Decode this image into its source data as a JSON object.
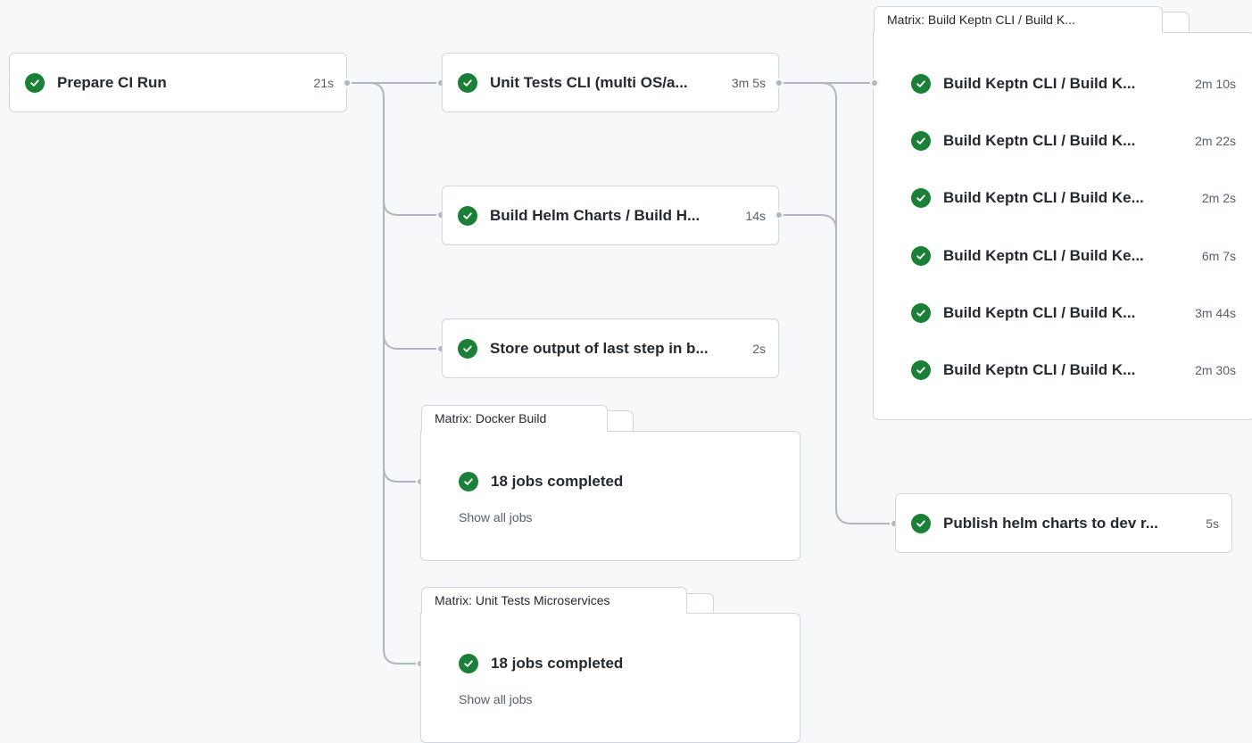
{
  "jobs": {
    "prepare": {
      "name": "Prepare CI Run",
      "duration": "21s"
    },
    "unit_cli": {
      "name": "Unit Tests CLI (multi OS/a...",
      "duration": "3m 5s"
    },
    "helm": {
      "name": "Build Helm Charts / Build H...",
      "duration": "14s"
    },
    "store": {
      "name": "Store output of last step in b...",
      "duration": "2s"
    },
    "publish": {
      "name": "Publish helm charts to dev r...",
      "duration": "5s"
    }
  },
  "matrix_docker": {
    "title": "Matrix: Docker Build",
    "summary": "18 jobs completed",
    "show_all": "Show all jobs"
  },
  "matrix_unit_ms": {
    "title": "Matrix: Unit Tests Microservices",
    "summary": "18 jobs completed",
    "show_all": "Show all jobs"
  },
  "matrix_cli": {
    "title": "Matrix: Build Keptn CLI / Build K...",
    "jobs": [
      {
        "name": "Build Keptn CLI / Build K...",
        "duration": "2m 10s"
      },
      {
        "name": "Build Keptn CLI / Build K...",
        "duration": "2m 22s"
      },
      {
        "name": "Build Keptn CLI / Build Ke...",
        "duration": "2m 2s"
      },
      {
        "name": "Build Keptn CLI / Build Ke...",
        "duration": "6m 7s"
      },
      {
        "name": "Build Keptn CLI / Build K...",
        "duration": "3m 44s"
      },
      {
        "name": "Build Keptn CLI / Build K...",
        "duration": "2m 30s"
      }
    ]
  },
  "colors": {
    "success": "#1a7f37",
    "connector": "#afb8c1",
    "border": "#d0d7de",
    "background": "#f6f8fa"
  },
  "icons": {
    "status": "check-circle-icon"
  }
}
